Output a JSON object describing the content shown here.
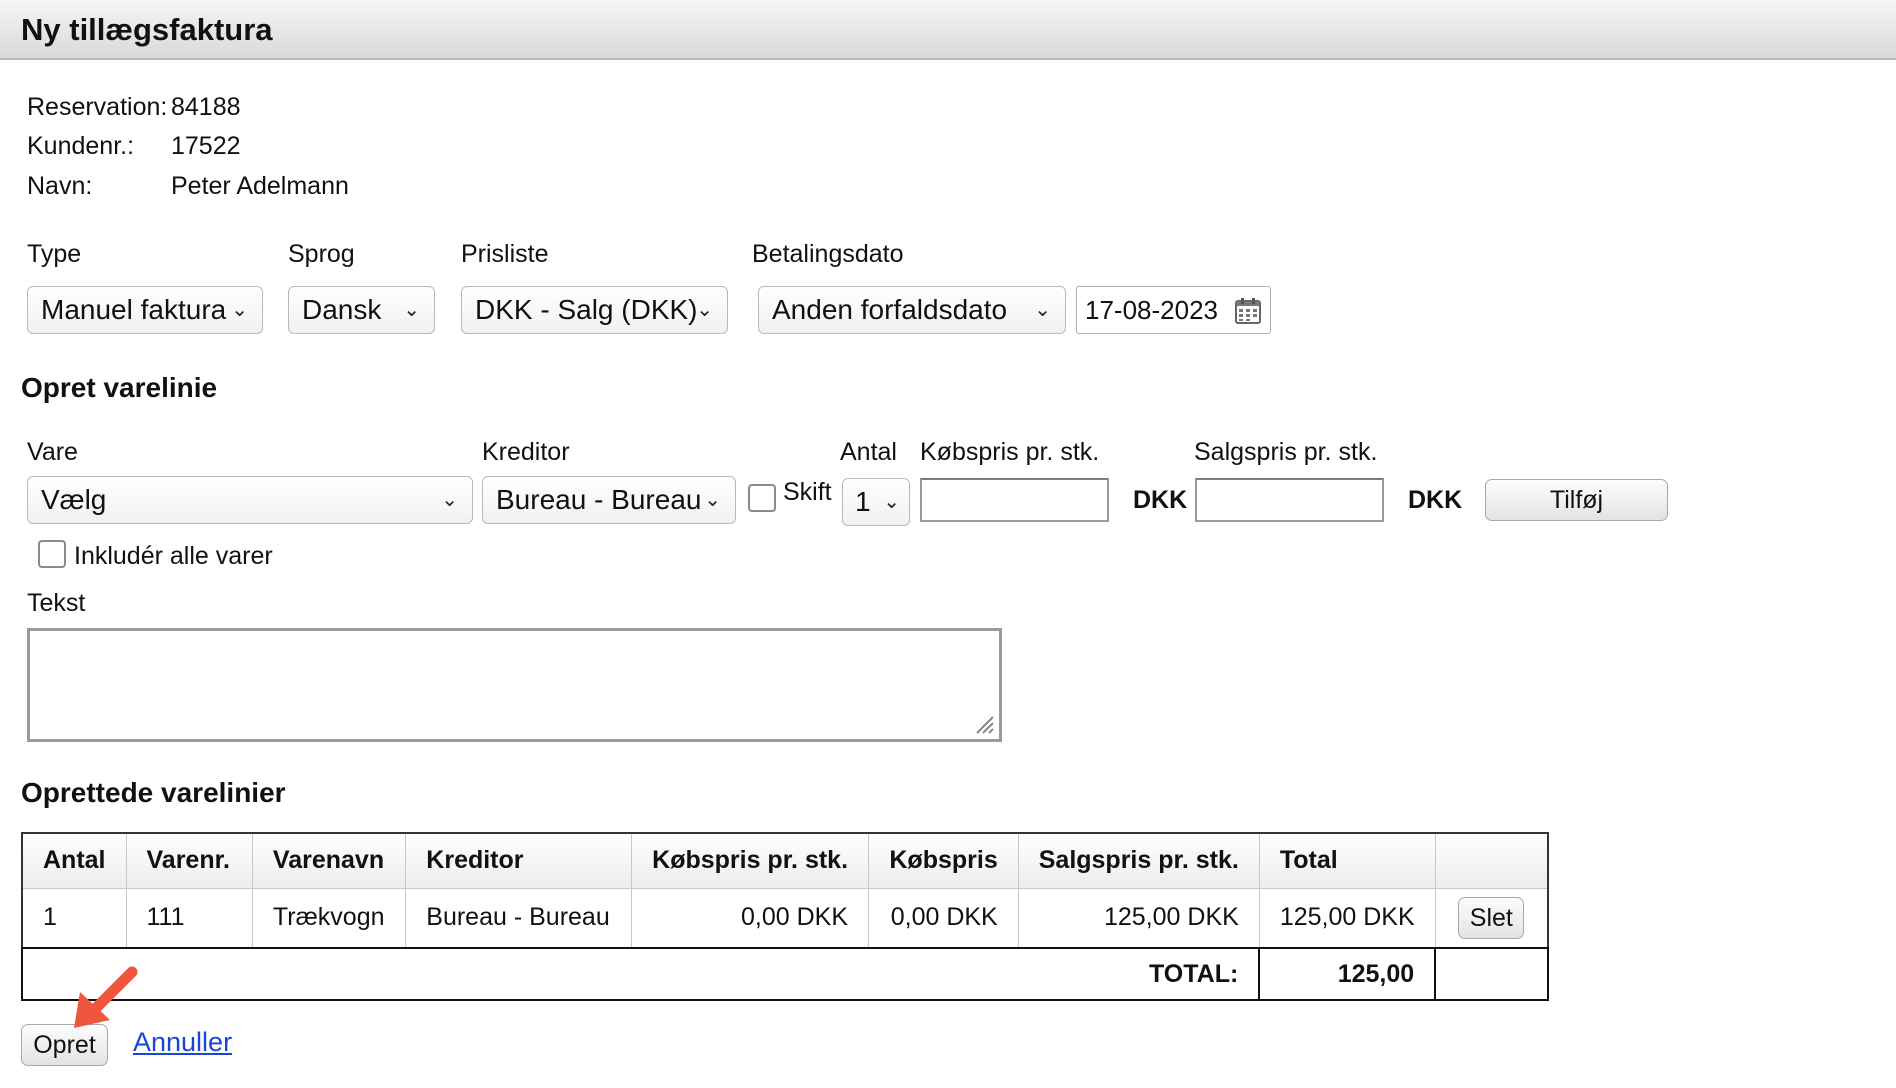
{
  "title": "Ny tillægsfaktura",
  "info": {
    "reservation_label": "Reservation:",
    "reservation_value": "84188",
    "kundenr_label": "Kundenr.:",
    "kundenr_value": "17522",
    "navn_label": "Navn:",
    "navn_value": "Peter Adelmann"
  },
  "invoice_settings": {
    "type_label": "Type",
    "type_value": "Manuel faktura",
    "sprog_label": "Sprog",
    "sprog_value": "Dansk",
    "prisliste_label": "Prisliste",
    "prisliste_value": "DKK - Salg (DKK)",
    "betalingsdato_label": "Betalingsdato",
    "betalingsdato_value": "Anden forfaldsdato",
    "date_value": "17-08-2023"
  },
  "create_line": {
    "heading": "Opret varelinie",
    "vare_label": "Vare",
    "vare_value": "Vælg",
    "kreditor_label": "Kreditor",
    "kreditor_value": "Bureau - Bureau",
    "skift_label": "Skift",
    "antal_label": "Antal",
    "antal_value": "1",
    "kobspris_label": "Købspris pr. stk.",
    "kobspris_value": "",
    "kobspris_currency": "DKK",
    "salgspris_label": "Salgspris pr. stk.",
    "salgspris_value": "",
    "salgspris_currency": "DKK",
    "add_button": "Tilføj",
    "include_all_label": "Inkludér alle varer",
    "tekst_label": "Tekst",
    "tekst_value": ""
  },
  "created_lines": {
    "heading": "Oprettede varelinier",
    "columns": [
      "Antal",
      "Varenr.",
      "Varenavn",
      "Kreditor",
      "Købspris pr. stk.",
      "Købspris",
      "Salgspris pr. stk.",
      "Total"
    ],
    "rows": [
      {
        "antal": "1",
        "varenr": "111",
        "varenavn": "Trækvogn",
        "kreditor": "Bureau - Bureau",
        "kobspris_stk": "0,00 DKK",
        "kobspris": "0,00 DKK",
        "salgspris_stk": "125,00 DKK",
        "total": "125,00 DKK",
        "delete_button": "Slet"
      }
    ],
    "total_label": "TOTAL:",
    "total_value": "125,00"
  },
  "actions": {
    "create_button": "Opret",
    "cancel_link": "Annuller"
  },
  "colors": {
    "link": "#1a44d6",
    "arrow": "#f0553d"
  }
}
